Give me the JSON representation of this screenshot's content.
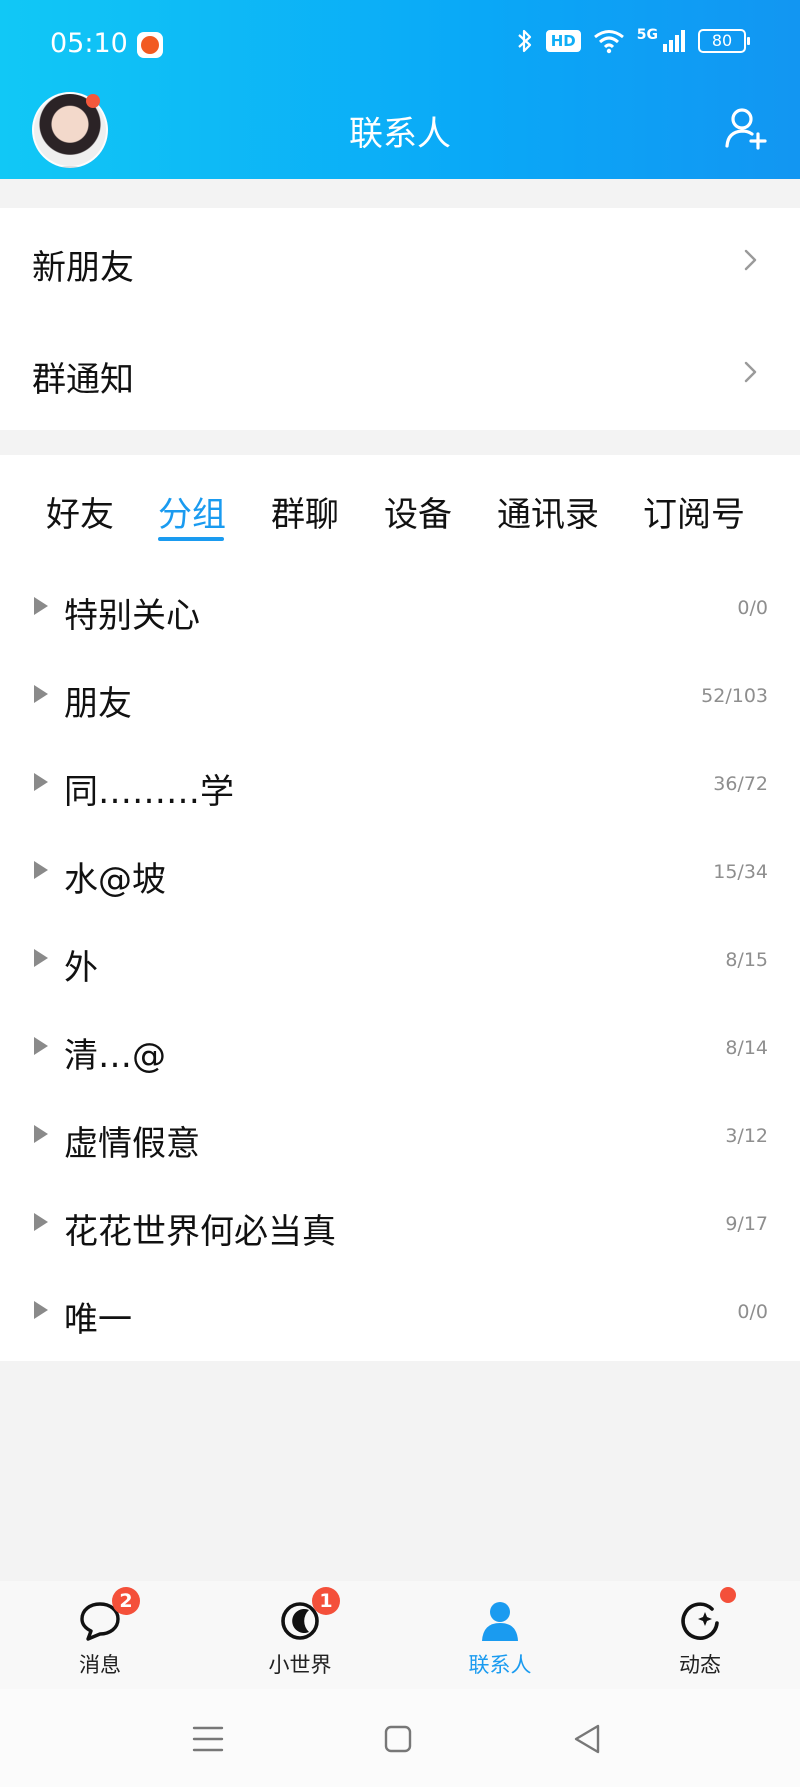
{
  "status_bar": {
    "time": "05:10",
    "hd": "HD",
    "network": "5G",
    "battery": "80"
  },
  "header": {
    "title": "联系人"
  },
  "top_entries": [
    {
      "label": "新朋友"
    },
    {
      "label": "群通知"
    }
  ],
  "tabs": [
    {
      "label": "好友"
    },
    {
      "label": "分组",
      "active": true
    },
    {
      "label": "群聊"
    },
    {
      "label": "设备"
    },
    {
      "label": "通讯录"
    },
    {
      "label": "订阅号"
    }
  ],
  "groups": [
    {
      "name": "特别关心",
      "count": "0/0"
    },
    {
      "name": "朋友",
      "count": "52/103"
    },
    {
      "name": "同………学",
      "count": "36/72"
    },
    {
      "name": "水@坡",
      "count": "15/34"
    },
    {
      "name": "外",
      "count": "8/15"
    },
    {
      "name": "清…@",
      "count": "8/14"
    },
    {
      "name": "虚情假意",
      "count": "3/12"
    },
    {
      "name": "花花世界何必当真",
      "count": "9/17"
    },
    {
      "name": "唯一",
      "count": "0/0"
    }
  ],
  "bottom_nav": [
    {
      "label": "消息",
      "badge": "2",
      "icon": "chat-bubble-icon"
    },
    {
      "label": "小世界",
      "badge": "1",
      "icon": "small-world-icon"
    },
    {
      "label": "联系人",
      "active": true,
      "icon": "contacts-person-icon"
    },
    {
      "label": "动态",
      "dot": true,
      "icon": "moments-star-icon"
    }
  ],
  "colors": {
    "accent": "#1a9bf0",
    "badge": "#f4503a",
    "header_start": "#11c8f6",
    "header_end": "#1296f2"
  }
}
